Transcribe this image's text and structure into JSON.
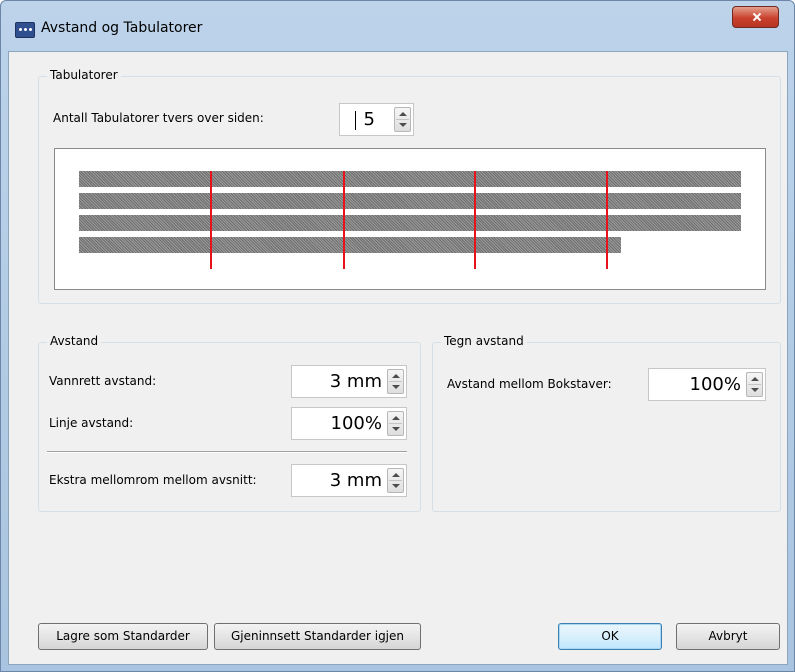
{
  "window": {
    "title": "Avstand og Tabulatorer"
  },
  "tabulatorer": {
    "legend": "Tabulatorer",
    "count_label": "Antall Tabulatorer tvers over siden:",
    "count_value": "5",
    "tab_count": 5
  },
  "avstand": {
    "legend": "Avstand",
    "horizontal_label": "Vannrett avstand:",
    "horizontal_value": "3 mm",
    "line_label": "Linje avstand:",
    "line_value": "100%",
    "paragraph_label": "Ekstra mellomrom mellom avsnitt:",
    "paragraph_value": "3 mm"
  },
  "tegn_avstand": {
    "legend": "Tegn avstand",
    "letter_label": "Avstand mellom Bokstaver:",
    "letter_value": "100%"
  },
  "buttons": {
    "save_defaults": "Lagre som Standarder",
    "restore_defaults": "Gjeninnsett Standarder igjen",
    "ok": "OK",
    "cancel": "Avbryt"
  },
  "colors": {
    "tab_marker": "#e8121b",
    "title_bar": "#bcd3ea",
    "close_button": "#c9422d"
  }
}
